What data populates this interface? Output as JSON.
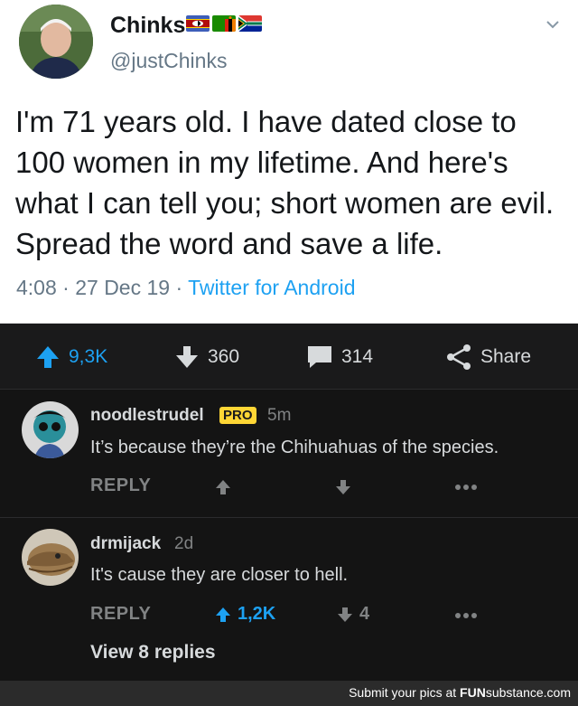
{
  "tweet": {
    "name": "Chinks",
    "handle": "@justChinks",
    "text": "I'm 71 years old. I have dated close to 100 women in my lifetime. And here's what I can tell you; short women are evil. Spread the word and save a life.",
    "time": "4:08",
    "date": "27 Dec 19",
    "source": "Twitter for Android",
    "separator": "·"
  },
  "actions": {
    "upvotes": "9,3K",
    "downvotes": "360",
    "comments": "314",
    "share": "Share"
  },
  "comments": [
    {
      "username": "noodlestrudel",
      "badge": "PRO",
      "age": "5m",
      "text": "It’s because they’re the Chihuahuas of the species.",
      "reply": "REPLY"
    },
    {
      "username": "drmijack",
      "age": "2d",
      "text": "It's cause they are closer to hell.",
      "reply": "REPLY",
      "upvotes": "1,2K",
      "downvotes": "4",
      "view_replies": "View 8 replies"
    }
  ],
  "footer": {
    "text": "Submit your pics at",
    "brand_bold": "FUN",
    "brand_rest": "substance.com"
  },
  "colors": {
    "upvote": "#1da1f2",
    "pro_badge": "#ffd635",
    "twitter_link": "#1da1f2"
  }
}
